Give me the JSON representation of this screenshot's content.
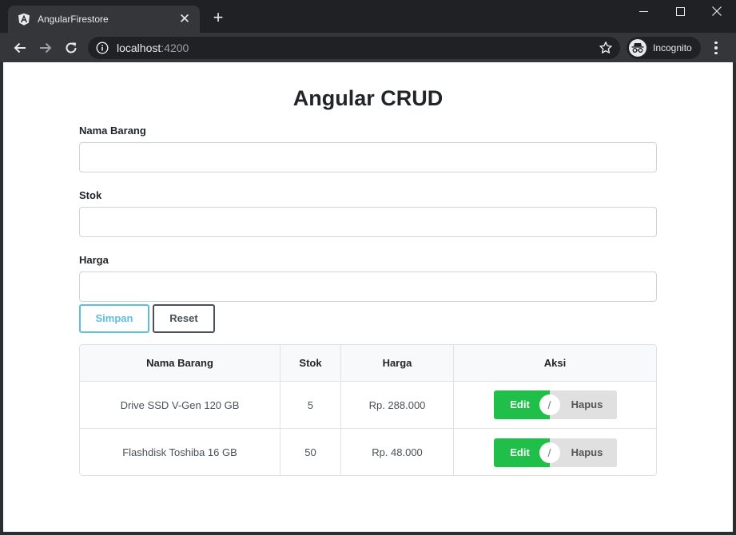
{
  "browser": {
    "tab_title": "AngularFirestore",
    "url_host": "localhost",
    "url_port": ":4200",
    "incognito_label": "Incognito"
  },
  "page": {
    "title": "Angular CRUD",
    "fields": [
      {
        "label": "Nama Barang",
        "value": ""
      },
      {
        "label": "Stok",
        "value": ""
      },
      {
        "label": "Harga",
        "value": ""
      }
    ],
    "buttons": {
      "save": "Simpan",
      "reset": "Reset"
    }
  },
  "table": {
    "headers": [
      "Nama Barang",
      "Stok",
      "Harga",
      "Aksi"
    ],
    "rows": [
      {
        "nama": "Drive SSD V-Gen 120 GB",
        "stok": "5",
        "harga": "Rp. 288.000",
        "edit": "Edit",
        "sep": "/",
        "hapus": "Hapus"
      },
      {
        "nama": "Flashdisk Toshiba 16 GB",
        "stok": "50",
        "harga": "Rp. 48.000",
        "edit": "Edit",
        "sep": "/",
        "hapus": "Hapus"
      }
    ]
  },
  "colors": {
    "edit_button": "#20bf4a",
    "hapus_button": "#e0e0e0",
    "simpan_border": "#5bc0de",
    "chrome_dark": "#202124",
    "chrome_toolbar": "#35363a"
  },
  "icons": [
    "angular-icon",
    "close-icon",
    "plus-icon",
    "minimize-icon",
    "maximize-icon",
    "back-arrow-icon",
    "forward-arrow-icon",
    "reload-icon",
    "info-icon",
    "star-icon",
    "incognito-icon",
    "kebab-menu-icon"
  ]
}
